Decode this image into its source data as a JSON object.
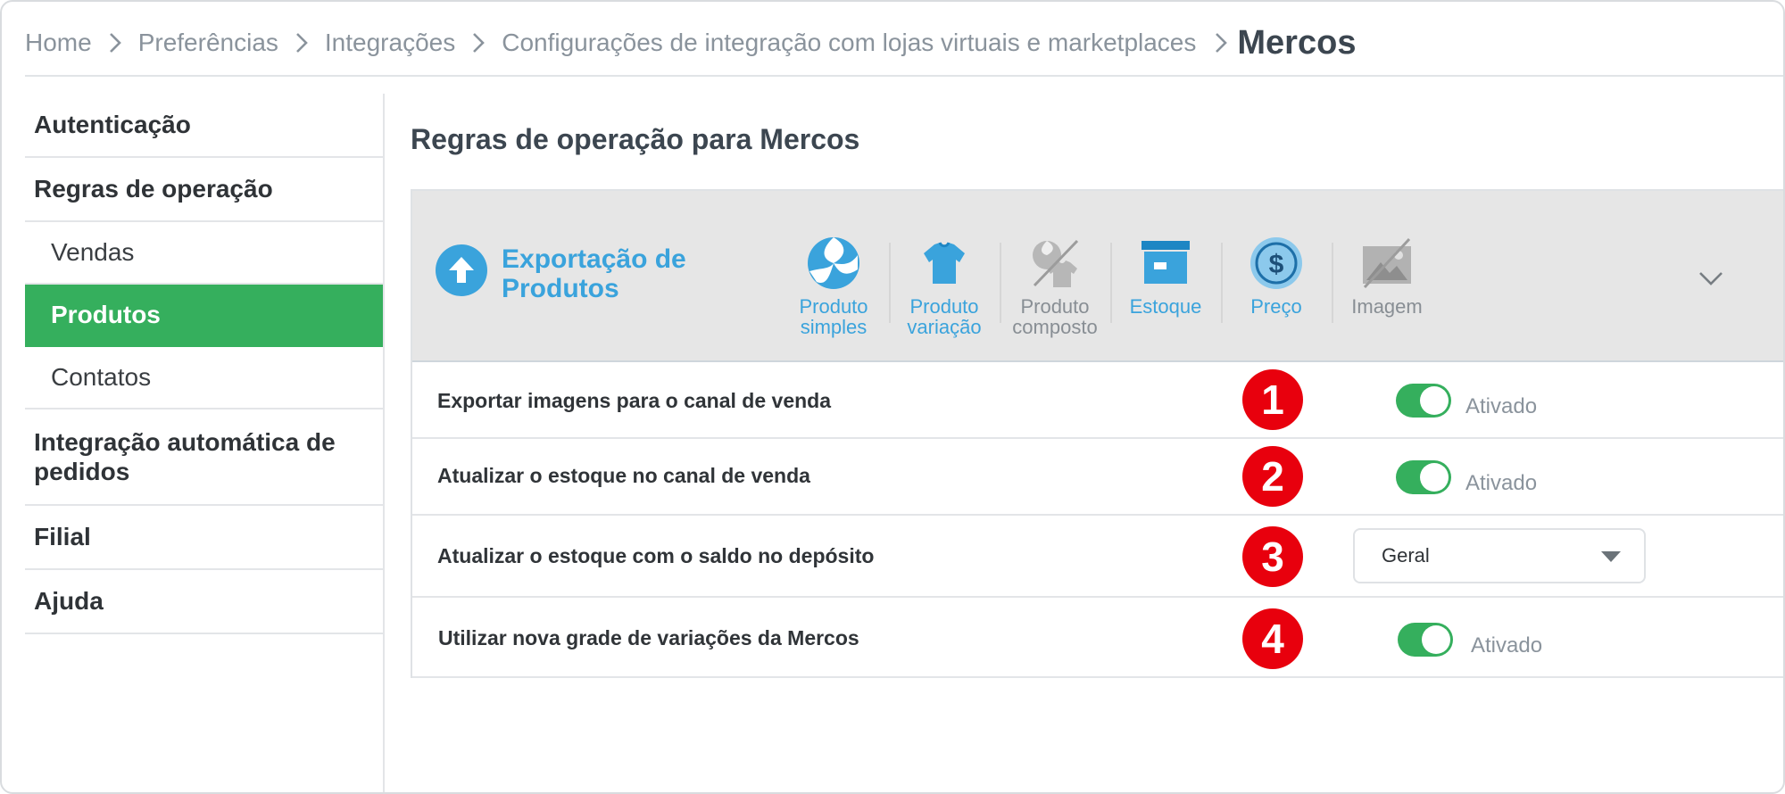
{
  "breadcrumb": {
    "items": [
      "Home",
      "Preferências",
      "Integrações",
      "Configurações de integração com lojas virtuais e marketplaces"
    ],
    "current": "Mercos"
  },
  "sidebar": {
    "items": [
      {
        "label": "Autenticação"
      },
      {
        "label": "Regras de operação"
      },
      {
        "label": "Vendas"
      },
      {
        "label": "Produtos"
      },
      {
        "label": "Contatos"
      },
      {
        "label": "Integração automática de pedidos"
      },
      {
        "label": "Filial"
      },
      {
        "label": "Ajuda"
      }
    ],
    "active_item": "Produtos"
  },
  "main": {
    "title": "Regras de operação para Mercos",
    "section": {
      "title": "Exportação de Produtos",
      "icon": "upload-arrow-icon",
      "tabs": [
        {
          "label_1": "Produto",
          "label_2": "simples",
          "icon": "beach-ball-icon",
          "state": "enabled"
        },
        {
          "label_1": "Produto",
          "label_2": "variação",
          "icon": "tshirt-icon",
          "state": "enabled"
        },
        {
          "label_1": "Produto",
          "label_2": "composto",
          "icon": "composite-product-icon",
          "state": "disabled"
        },
        {
          "label_1": "Estoque",
          "label_2": "",
          "icon": "stock-box-icon",
          "state": "enabled"
        },
        {
          "label_1": "Preço",
          "label_2": "",
          "icon": "dollar-icon",
          "state": "enabled"
        },
        {
          "label_1": "Imagem",
          "label_2": "",
          "icon": "image-icon",
          "state": "disabled"
        }
      ]
    },
    "rows": [
      {
        "label": "Exportar imagens para o canal de venda",
        "badge": "1",
        "toggle_on": true,
        "status": "Ativado"
      },
      {
        "label": "Atualizar o estoque no canal de venda",
        "badge": "2",
        "toggle_on": true,
        "status": "Ativado"
      },
      {
        "label": "Atualizar o estoque com o saldo no depósito",
        "badge": "3",
        "select_value": "Geral"
      },
      {
        "label": "Utilizar nova grade de variações da Mercos",
        "badge": "4",
        "toggle_on": true,
        "status": "Ativado"
      }
    ]
  },
  "colors": {
    "accent_green": "#35af5d",
    "accent_blue": "#3aa3dc",
    "badge_red": "#e8000d",
    "muted_text": "#8a939c"
  }
}
